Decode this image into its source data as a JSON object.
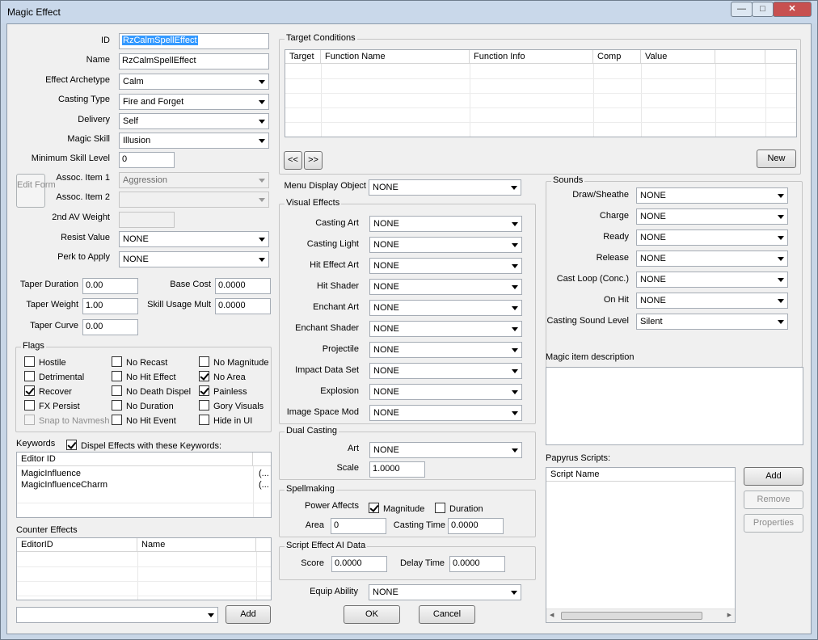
{
  "window": {
    "title": "Magic Effect",
    "min_icon": "minimize-icon",
    "max_icon": "maximize-icon",
    "close_icon": "close-icon"
  },
  "left": {
    "id_label": "ID",
    "id_value": "RzCalmSpellEffect",
    "name_label": "Name",
    "name_value": "RzCalmSpellEffect",
    "archetype_label": "Effect Archetype",
    "archetype_value": "Calm",
    "casting_type_label": "Casting Type",
    "casting_type_value": "Fire and Forget",
    "delivery_label": "Delivery",
    "delivery_value": "Self",
    "magic_skill_label": "Magic Skill",
    "magic_skill_value": "Illusion",
    "min_skill_label": "Minimum Skill Level",
    "min_skill_value": "0",
    "edit_form_label": "Edit Form",
    "assoc1_label": "Assoc. Item 1",
    "assoc1_value": "Aggression",
    "assoc2_label": "Assoc. Item 2",
    "assoc2_value": "",
    "av_weight_label": "2nd AV Weight",
    "av_weight_value": "",
    "resist_label": "Resist Value",
    "resist_value": "NONE",
    "perk_label": "Perk to Apply",
    "perk_value": "NONE",
    "taper_duration_label": "Taper Duration",
    "taper_duration_value": "0.00",
    "base_cost_label": "Base Cost",
    "base_cost_value": "0.0000",
    "taper_weight_label": "Taper Weight",
    "taper_weight_value": "1.00",
    "skill_usage_label": "Skill Usage Mult",
    "skill_usage_value": "0.0000",
    "taper_curve_label": "Taper Curve",
    "taper_curve_value": "0.00"
  },
  "flags": {
    "title": "Flags",
    "items": [
      {
        "label": "Hostile",
        "checked": false,
        "disabled": false
      },
      {
        "label": "No Recast",
        "checked": false,
        "disabled": false
      },
      {
        "label": "No Magnitude",
        "checked": false,
        "disabled": false
      },
      {
        "label": "Detrimental",
        "checked": false,
        "disabled": false
      },
      {
        "label": "No Hit Effect",
        "checked": false,
        "disabled": false
      },
      {
        "label": "No Area",
        "checked": true,
        "disabled": false
      },
      {
        "label": "Recover",
        "checked": true,
        "disabled": false
      },
      {
        "label": "No Death Dispel",
        "checked": false,
        "disabled": false
      },
      {
        "label": "Painless",
        "checked": true,
        "disabled": false
      },
      {
        "label": "FX Persist",
        "checked": false,
        "disabled": false
      },
      {
        "label": "No Duration",
        "checked": false,
        "disabled": false
      },
      {
        "label": "Gory Visuals",
        "checked": false,
        "disabled": false
      },
      {
        "label": "Snap to Navmesh",
        "checked": false,
        "disabled": true
      },
      {
        "label": "No Hit Event",
        "checked": false,
        "disabled": false
      },
      {
        "label": "Hide in UI",
        "checked": false,
        "disabled": false
      }
    ]
  },
  "keywords": {
    "label": "Keywords",
    "dispel_label": "Dispel Effects with these Keywords:",
    "dispel_checked": true,
    "column": "Editor ID",
    "rows": [
      {
        "name": "MagicInfluence",
        "extra": "(..."
      },
      {
        "name": "MagicInfluenceCharm",
        "extra": "(..."
      }
    ]
  },
  "counter": {
    "label": "Counter Effects",
    "columns": [
      "EditorID",
      "Name"
    ],
    "select_value": "",
    "add_label": "Add"
  },
  "target": {
    "title": "Target Conditions",
    "columns": [
      "Target",
      "Function Name",
      "Function Info",
      "Comp",
      "Value"
    ],
    "prev_label": "<<",
    "next_label": ">>",
    "new_label": "New"
  },
  "menu_display": {
    "label": "Menu Display Object",
    "value": "NONE"
  },
  "visual": {
    "title": "Visual Effects",
    "items": [
      {
        "label": "Casting Art",
        "value": "NONE"
      },
      {
        "label": "Casting Light",
        "value": "NONE"
      },
      {
        "label": "Hit Effect Art",
        "value": "NONE"
      },
      {
        "label": "Hit Shader",
        "value": "NONE"
      },
      {
        "label": "Enchant Art",
        "value": "NONE"
      },
      {
        "label": "Enchant Shader",
        "value": "NONE"
      },
      {
        "label": "Projectile",
        "value": "NONE"
      },
      {
        "label": "Impact Data Set",
        "value": "NONE"
      },
      {
        "label": "Explosion",
        "value": "NONE"
      },
      {
        "label": "Image Space Mod",
        "value": "NONE"
      }
    ]
  },
  "dual": {
    "title": "Dual Casting",
    "art_label": "Art",
    "art_value": "NONE",
    "scale_label": "Scale",
    "scale_value": "1.0000"
  },
  "spell": {
    "title": "Spellmaking",
    "power_label": "Power Affects",
    "magnitude_label": "Magnitude",
    "magnitude_checked": true,
    "duration_label": "Duration",
    "duration_checked": false,
    "area_label": "Area",
    "area_value": "0",
    "casting_time_label": "Casting Time",
    "casting_time_value": "0.0000"
  },
  "ai": {
    "title": "Script Effect AI Data",
    "score_label": "Score",
    "score_value": "0.0000",
    "delay_label": "Delay Time",
    "delay_value": "0.0000"
  },
  "equip": {
    "label": "Equip Ability",
    "value": "NONE"
  },
  "buttons": {
    "ok": "OK",
    "cancel": "Cancel"
  },
  "sounds": {
    "title": "Sounds",
    "items": [
      {
        "label": "Draw/Sheathe",
        "value": "NONE"
      },
      {
        "label": "Charge",
        "value": "NONE"
      },
      {
        "label": "Ready",
        "value": "NONE"
      },
      {
        "label": "Release",
        "value": "NONE"
      },
      {
        "label": "Cast Loop (Conc.)",
        "value": "NONE"
      },
      {
        "label": "On Hit",
        "value": "NONE"
      },
      {
        "label": "Casting Sound Level",
        "value": "Silent"
      }
    ]
  },
  "description": {
    "label": "Magic item description",
    "value": ""
  },
  "papyrus": {
    "label": "Papyrus Scripts:",
    "column": "Script Name",
    "add": "Add",
    "remove": "Remove",
    "properties": "Properties"
  }
}
